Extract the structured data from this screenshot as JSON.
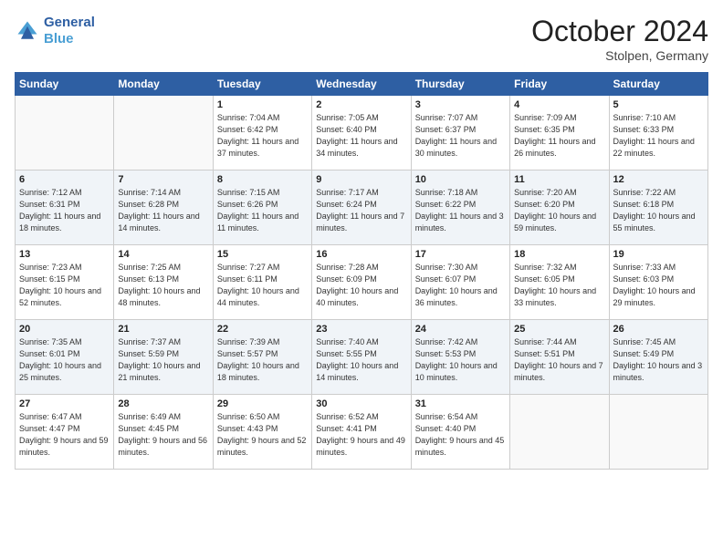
{
  "header": {
    "logo_line1": "General",
    "logo_line2": "Blue",
    "month_title": "October 2024",
    "location": "Stolpen, Germany"
  },
  "days_of_week": [
    "Sunday",
    "Monday",
    "Tuesday",
    "Wednesday",
    "Thursday",
    "Friday",
    "Saturday"
  ],
  "weeks": [
    [
      {
        "day": "",
        "info": ""
      },
      {
        "day": "",
        "info": ""
      },
      {
        "day": "1",
        "info": "Sunrise: 7:04 AM\nSunset: 6:42 PM\nDaylight: 11 hours and 37 minutes."
      },
      {
        "day": "2",
        "info": "Sunrise: 7:05 AM\nSunset: 6:40 PM\nDaylight: 11 hours and 34 minutes."
      },
      {
        "day": "3",
        "info": "Sunrise: 7:07 AM\nSunset: 6:37 PM\nDaylight: 11 hours and 30 minutes."
      },
      {
        "day": "4",
        "info": "Sunrise: 7:09 AM\nSunset: 6:35 PM\nDaylight: 11 hours and 26 minutes."
      },
      {
        "day": "5",
        "info": "Sunrise: 7:10 AM\nSunset: 6:33 PM\nDaylight: 11 hours and 22 minutes."
      }
    ],
    [
      {
        "day": "6",
        "info": "Sunrise: 7:12 AM\nSunset: 6:31 PM\nDaylight: 11 hours and 18 minutes."
      },
      {
        "day": "7",
        "info": "Sunrise: 7:14 AM\nSunset: 6:28 PM\nDaylight: 11 hours and 14 minutes."
      },
      {
        "day": "8",
        "info": "Sunrise: 7:15 AM\nSunset: 6:26 PM\nDaylight: 11 hours and 11 minutes."
      },
      {
        "day": "9",
        "info": "Sunrise: 7:17 AM\nSunset: 6:24 PM\nDaylight: 11 hours and 7 minutes."
      },
      {
        "day": "10",
        "info": "Sunrise: 7:18 AM\nSunset: 6:22 PM\nDaylight: 11 hours and 3 minutes."
      },
      {
        "day": "11",
        "info": "Sunrise: 7:20 AM\nSunset: 6:20 PM\nDaylight: 10 hours and 59 minutes."
      },
      {
        "day": "12",
        "info": "Sunrise: 7:22 AM\nSunset: 6:18 PM\nDaylight: 10 hours and 55 minutes."
      }
    ],
    [
      {
        "day": "13",
        "info": "Sunrise: 7:23 AM\nSunset: 6:15 PM\nDaylight: 10 hours and 52 minutes."
      },
      {
        "day": "14",
        "info": "Sunrise: 7:25 AM\nSunset: 6:13 PM\nDaylight: 10 hours and 48 minutes."
      },
      {
        "day": "15",
        "info": "Sunrise: 7:27 AM\nSunset: 6:11 PM\nDaylight: 10 hours and 44 minutes."
      },
      {
        "day": "16",
        "info": "Sunrise: 7:28 AM\nSunset: 6:09 PM\nDaylight: 10 hours and 40 minutes."
      },
      {
        "day": "17",
        "info": "Sunrise: 7:30 AM\nSunset: 6:07 PM\nDaylight: 10 hours and 36 minutes."
      },
      {
        "day": "18",
        "info": "Sunrise: 7:32 AM\nSunset: 6:05 PM\nDaylight: 10 hours and 33 minutes."
      },
      {
        "day": "19",
        "info": "Sunrise: 7:33 AM\nSunset: 6:03 PM\nDaylight: 10 hours and 29 minutes."
      }
    ],
    [
      {
        "day": "20",
        "info": "Sunrise: 7:35 AM\nSunset: 6:01 PM\nDaylight: 10 hours and 25 minutes."
      },
      {
        "day": "21",
        "info": "Sunrise: 7:37 AM\nSunset: 5:59 PM\nDaylight: 10 hours and 21 minutes."
      },
      {
        "day": "22",
        "info": "Sunrise: 7:39 AM\nSunset: 5:57 PM\nDaylight: 10 hours and 18 minutes."
      },
      {
        "day": "23",
        "info": "Sunrise: 7:40 AM\nSunset: 5:55 PM\nDaylight: 10 hours and 14 minutes."
      },
      {
        "day": "24",
        "info": "Sunrise: 7:42 AM\nSunset: 5:53 PM\nDaylight: 10 hours and 10 minutes."
      },
      {
        "day": "25",
        "info": "Sunrise: 7:44 AM\nSunset: 5:51 PM\nDaylight: 10 hours and 7 minutes."
      },
      {
        "day": "26",
        "info": "Sunrise: 7:45 AM\nSunset: 5:49 PM\nDaylight: 10 hours and 3 minutes."
      }
    ],
    [
      {
        "day": "27",
        "info": "Sunrise: 6:47 AM\nSunset: 4:47 PM\nDaylight: 9 hours and 59 minutes."
      },
      {
        "day": "28",
        "info": "Sunrise: 6:49 AM\nSunset: 4:45 PM\nDaylight: 9 hours and 56 minutes."
      },
      {
        "day": "29",
        "info": "Sunrise: 6:50 AM\nSunset: 4:43 PM\nDaylight: 9 hours and 52 minutes."
      },
      {
        "day": "30",
        "info": "Sunrise: 6:52 AM\nSunset: 4:41 PM\nDaylight: 9 hours and 49 minutes."
      },
      {
        "day": "31",
        "info": "Sunrise: 6:54 AM\nSunset: 4:40 PM\nDaylight: 9 hours and 45 minutes."
      },
      {
        "day": "",
        "info": ""
      },
      {
        "day": "",
        "info": ""
      }
    ]
  ]
}
